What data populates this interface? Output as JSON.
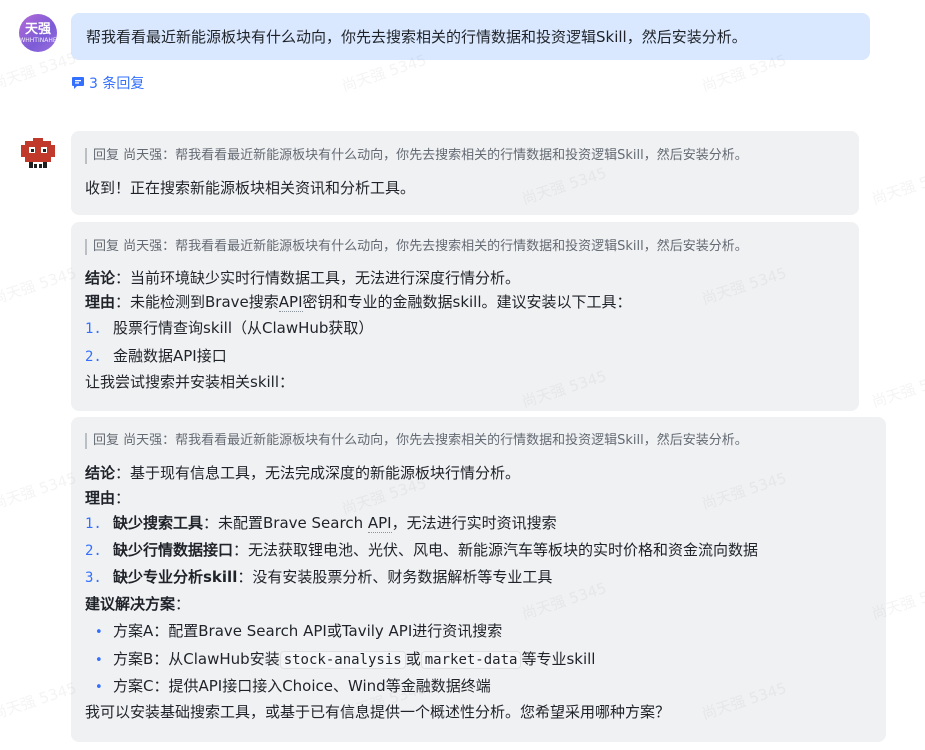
{
  "user": {
    "avatar_text": "天强",
    "avatar_subtext": "WHHTINAHE"
  },
  "user_message": "帮我看看最近新能源板块有什么动向，你先去搜索相关的行情数据和投资逻辑Skill，然后安装分析。",
  "reply_count": "3 条回复",
  "quote_text": "回复 尚天强：帮我看看最近新能源板块有什么动向，你先去搜索相关的行情数据和投资逻辑Skill，然后安装分析。",
  "msg1": {
    "text": "收到！正在搜索新能源板块相关资讯和分析工具。"
  },
  "msg2": {
    "conclusion_label": "结论",
    "conclusion_text": "：当前环境缺少实时行情数据工具，无法进行深度行情分析。",
    "reason_label": "理由",
    "reason_text_pre": "：未能检测到Brave搜索",
    "reason_api": "API",
    "reason_text_post": "密钥和专业的金融数据skill。建议安装以下工具：",
    "items": [
      {
        "num": "1.",
        "text": "股票行情查询skill（从ClawHub获取）"
      },
      {
        "num": "2.",
        "text": "金融数据API接口"
      }
    ],
    "closing": "让我尝试搜索并安装相关skill："
  },
  "msg3": {
    "conclusion_label": "结论",
    "conclusion_text": "：基于现有信息工具，无法完成深度的新能源板块行情分析。",
    "reason_label": "理由",
    "reason_colon": "：",
    "items": [
      {
        "num": "1.",
        "label": "缺少搜索工具",
        "text_pre": "：未配置Brave Search ",
        "text_api": "API",
        "text_post": "，无法进行实时资讯搜索"
      },
      {
        "num": "2.",
        "label": "缺少行情数据接口",
        "text_pre": "：无法获取锂电池、光伏、风电、新能源汽车等板块的实时价格和资金流向数据",
        "text_api": "",
        "text_post": ""
      },
      {
        "num": "3.",
        "label": "缺少专业分析skill",
        "text_pre": "：没有安装股票分析、财务数据解析等专业工具",
        "text_api": "",
        "text_post": ""
      }
    ],
    "suggest_label": "建议解决方案",
    "suggest_colon": "：",
    "options": {
      "a": "方案A：配置Brave Search API或Tavily API进行资讯搜索",
      "b_pre": "方案B：从ClawHub安装",
      "b_code1": "stock-analysis",
      "b_mid": "或",
      "b_code2": "market-data",
      "b_post": "等专业skill",
      "c": "方案C：提供API接口接入Choice、Wind等金融数据终端"
    },
    "closing": "我可以安装基础搜索工具，或基于已有信息提供一个概述性分析。您希望采用哪种方案？"
  },
  "watermark_text": "尚天强 5345",
  "colors": {
    "accent": "#3370ff",
    "user_bubble": "#d9e8ff",
    "bot_bubble": "#f0f1f3"
  }
}
